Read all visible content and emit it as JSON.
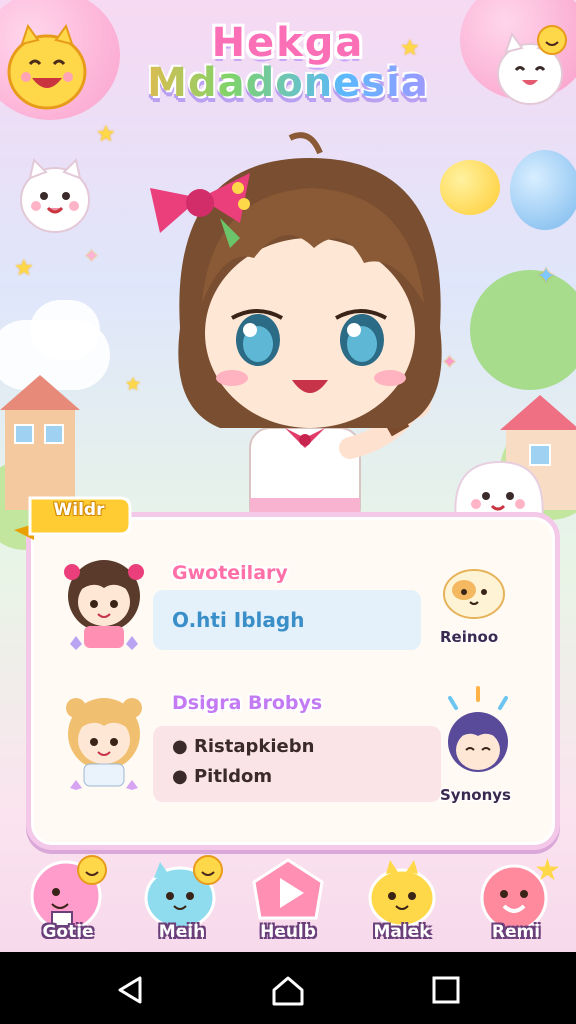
{
  "title": {
    "line1": "Hekɡa",
    "line2": "Mdadonesia"
  },
  "panel": {
    "ribbon_label": "Wildr",
    "row1": {
      "title": "Gwoteilary",
      "field_text": "O.hti Iblagh",
      "side_label": "Reinoo"
    },
    "row2": {
      "title": "Dsigra Brobys",
      "bullets": [
        "Ristapkiebn",
        "Pitldom"
      ],
      "side_label": "Synonys"
    }
  },
  "bottom_buttons": [
    {
      "label": "Gotie",
      "icon": "pink-bunny-icon",
      "color": "#ff9ccc"
    },
    {
      "label": "Meih",
      "icon": "blue-cat-icon",
      "color": "#8fdcef"
    },
    {
      "label": "Heulb",
      "icon": "play-icon",
      "color": "#ff8fb3"
    },
    {
      "label": "Malek",
      "icon": "yellow-chick-icon",
      "color": "#ffd84a"
    },
    {
      "label": "Remi",
      "icon": "pink-face-icon",
      "color": "#ff8a9e"
    }
  ],
  "nav": {
    "back": "back-icon",
    "home": "home-icon",
    "recents": "recents-icon"
  }
}
